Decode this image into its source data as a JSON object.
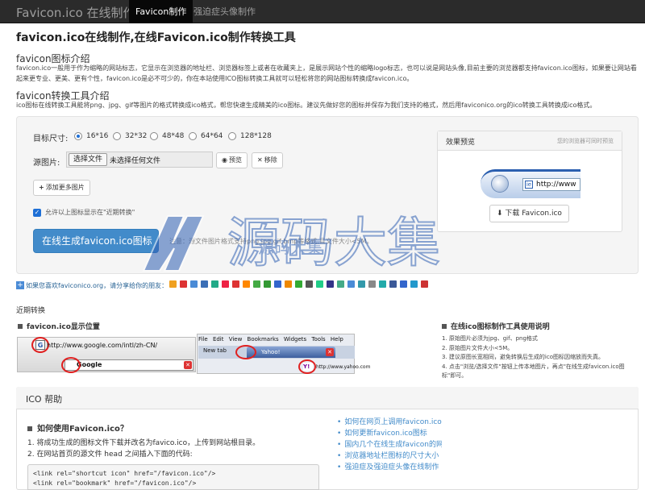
{
  "navbar": {
    "brand": "Favicon.ico 在线制作",
    "tabs": [
      {
        "label": "Favicon制作",
        "active": true
      },
      {
        "label": "强迫症头像制作",
        "active": false
      }
    ]
  },
  "page_title": "favicon.ico在线制作,在线Favicon.ico制作转换工具",
  "intro": {
    "heading": "favicon图标介绍",
    "text": "favicon.ico一般用于作为缩略的网站标志，它显示在浏览器的地址栏、浏览器标签上或者在收藏夹上，是展示网站个性的缩略logo标志，也可以说是网站头像,目前主要的浏览器都支持favicon.ico图标，如果要让网站看起来更专业、更美、更有个性，favicon.ico是必不可少的，你在本站使用ICO图标转换工具就可以轻松将您的网站图标转换成favicon.ico。"
  },
  "tool_intro": {
    "heading": "favicon转换工具介绍",
    "text": "ico图标在线转换工具能将png、jpg、gif等图片的格式转换成ico格式，帮您快速生成精美的ico图标。建议先做好您的图标并保存为我们支持的格式，然后用faviconico.org的ico转换工具转换成ico格式。"
  },
  "form": {
    "size_label": "目标尺寸:",
    "sizes": [
      {
        "label": "16*16",
        "checked": true
      },
      {
        "label": "32*32",
        "checked": false
      },
      {
        "label": "48*48",
        "checked": false
      },
      {
        "label": "64*64",
        "checked": false
      },
      {
        "label": "128*128",
        "checked": false
      }
    ],
    "source_label": "源图片:",
    "file_button": "选择文件",
    "file_none": "未选择任何文件",
    "preview_button": "预览",
    "remove_button": "移除",
    "add_more_button": "添加更多图片",
    "show_recent_label": "允许以上图标显示在\"近期转换\"",
    "generate_button": "在线生成favicon.ico图标",
    "hint": "注意：源文件图片格式支持png,jpg,gif,bmp等格式,且文件大小<5M。"
  },
  "preview": {
    "title": "效果预览",
    "note": "您的浏览器可同时预览",
    "url": "http://www",
    "download_button": "下载 Favicon.ico"
  },
  "share": {
    "text": "如果您喜欢faviconico.org，请分享给你的朋友：",
    "icon_colors": [
      "#f0a020",
      "#d33",
      "#4a8bd6",
      "#3b6fb6",
      "#2a8",
      "#e24",
      "#d33",
      "#f80",
      "#4a4",
      "#393",
      "#36c",
      "#e80",
      "#3a3",
      "#555",
      "#2c8",
      "#338",
      "#4a8",
      "#4a8bd6",
      "#39a",
      "#888",
      "#2aa",
      "#3b5998",
      "#36c",
      "#29c",
      "#c33"
    ]
  },
  "recent_title": "近期转换",
  "display": {
    "title": "favicon.ico显示位置",
    "shot_url": "http://www.google.com/intl/zh-CN/",
    "shot_fav": "G",
    "shot_google": "Google",
    "menu": "File  Edit  View  Bookmarks  Widgets  Tools  Help",
    "new_tab": "New tab",
    "yahoo_tab": "Yahoo!",
    "yahoo_fav": "Y!",
    "yahoo_url": "http://www.yahoo.com"
  },
  "instructions": {
    "title": "在线ico图标制作工具使用说明",
    "items": [
      "1. 原始图片必须为jpg、gif、png格式",
      "2. 原始图片文件大小<5M。",
      "3. 建议原图长宽相同，避免转换后生成的ico图标因缩放而失真。",
      "4. 点击\"浏览/选择文件\"按钮上传本地图片，再点\"在线生成favicon.ico图标\"即可。"
    ]
  },
  "help": {
    "title": "ICO 帮助",
    "question": "如何使用Favicon.ico？",
    "steps": [
      "1. 将成功生成的图标文件下载并改名为favico.ico，上传到网站根目录。",
      "2. 在网站首页的源文件 head 之间插入下面的代码:"
    ],
    "code_lines": [
      "<link rel=\"shortcut icon\" href=\"/favicon.ico\"/>",
      "<link rel=\"bookmark\" href=\"/favicon.ico\"/>"
    ],
    "links": [
      "如何在网页上调用favicon.ico",
      "如何更新favicon.ico图标",
      "国内几个在线生成favicon的网站",
      "浏览器地址栏图标的尺寸大小",
      "强迫症及强迫症头像在线制作"
    ]
  },
  "watermark": {
    "text": "源码大集",
    "sub": "源码大集",
    "color": "#2f5fb3"
  }
}
